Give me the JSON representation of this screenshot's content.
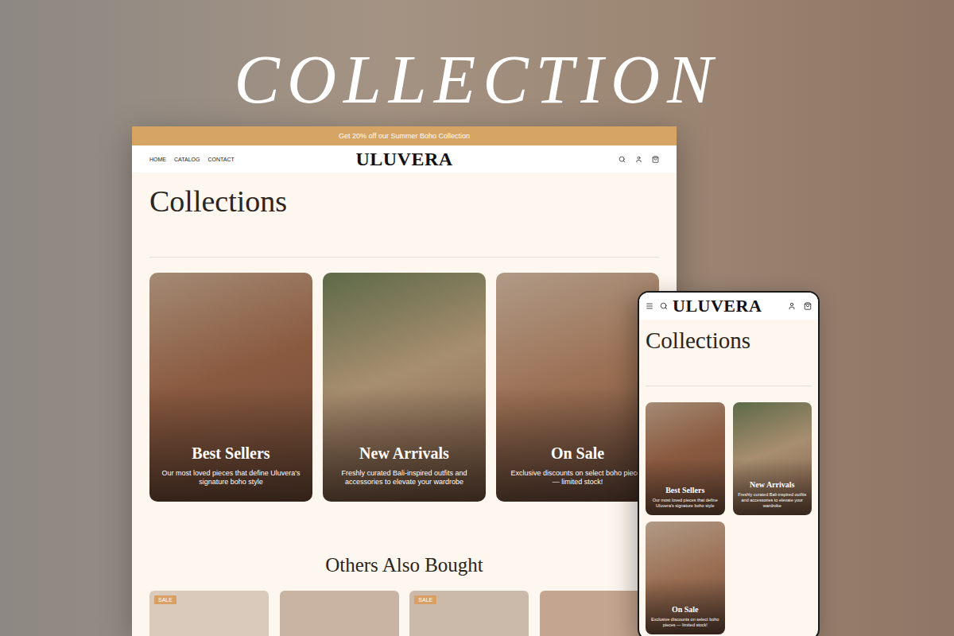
{
  "headline": "COLLECTION",
  "desktop": {
    "announcement": "Get 20% off our Summer Boho Collection",
    "nav": [
      "HOME",
      "CATALOG",
      "CONTACT"
    ],
    "logo": "ULUVERA",
    "heading": "Collections",
    "collections": [
      {
        "title": "Best Sellers",
        "description": "Our most loved pieces that define Uluvera's signature boho style"
      },
      {
        "title": "New Arrivals",
        "description": "Freshly curated Bali-inspired outfits and accessories to elevate your wardrobe"
      },
      {
        "title": "On Sale",
        "description": "Exclusive discounts on select boho pieces — limited stock!"
      }
    ],
    "related": {
      "title": "Others Also Bought",
      "products": [
        {
          "on_sale": true,
          "badge": "SALE"
        },
        {
          "on_sale": false,
          "badge": ""
        },
        {
          "on_sale": true,
          "badge": "SALE"
        },
        {
          "on_sale": false,
          "badge": ""
        }
      ]
    }
  },
  "mobile": {
    "logo": "ULUVERA",
    "heading": "Collections",
    "collections": [
      {
        "title": "Best Sellers",
        "description": "Our most loved pieces that define Uluvera's signature boho style"
      },
      {
        "title": "New Arrivals",
        "description": "Freshly curated Bali-inspired outfits and accessories to elevate your wardrobe"
      },
      {
        "title": "On Sale",
        "description": "Exclusive discounts on select boho pieces — limited stock!"
      }
    ]
  }
}
